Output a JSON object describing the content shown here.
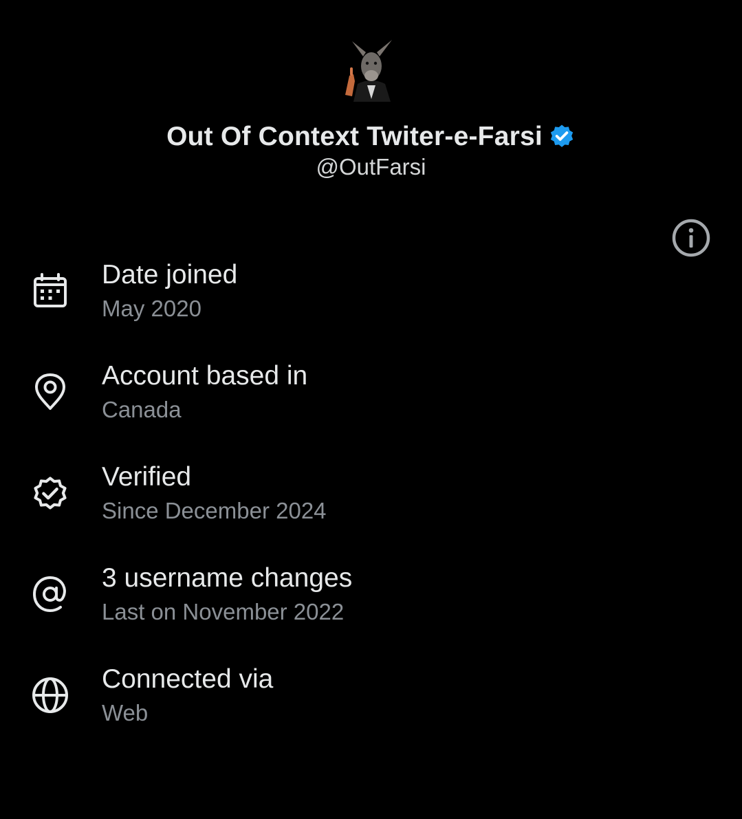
{
  "profile": {
    "display_name": "Out Of Context Twiter-e-Farsi",
    "handle": "@OutFarsi",
    "verified_badge_color": "#1d9bf0"
  },
  "about_rows": [
    {
      "icon": "calendar-icon",
      "title": "Date joined",
      "subtitle": "May 2020"
    },
    {
      "icon": "location-pin-icon",
      "title": "Account based in",
      "subtitle": "Canada"
    },
    {
      "icon": "verified-badge-icon",
      "title": "Verified",
      "subtitle": "Since December 2024"
    },
    {
      "icon": "at-sign-icon",
      "title": "3 username changes",
      "subtitle": "Last on November 2022"
    },
    {
      "icon": "globe-icon",
      "title": "Connected via",
      "subtitle": "Web"
    }
  ],
  "info_button": {
    "icon": "info-icon"
  },
  "colors": {
    "background": "#000000",
    "primary_text": "#e7e9ea",
    "secondary_text": "#8b9096",
    "icon_stroke": "#e7e9ea",
    "info_icon_stroke": "#a5a9ad"
  }
}
